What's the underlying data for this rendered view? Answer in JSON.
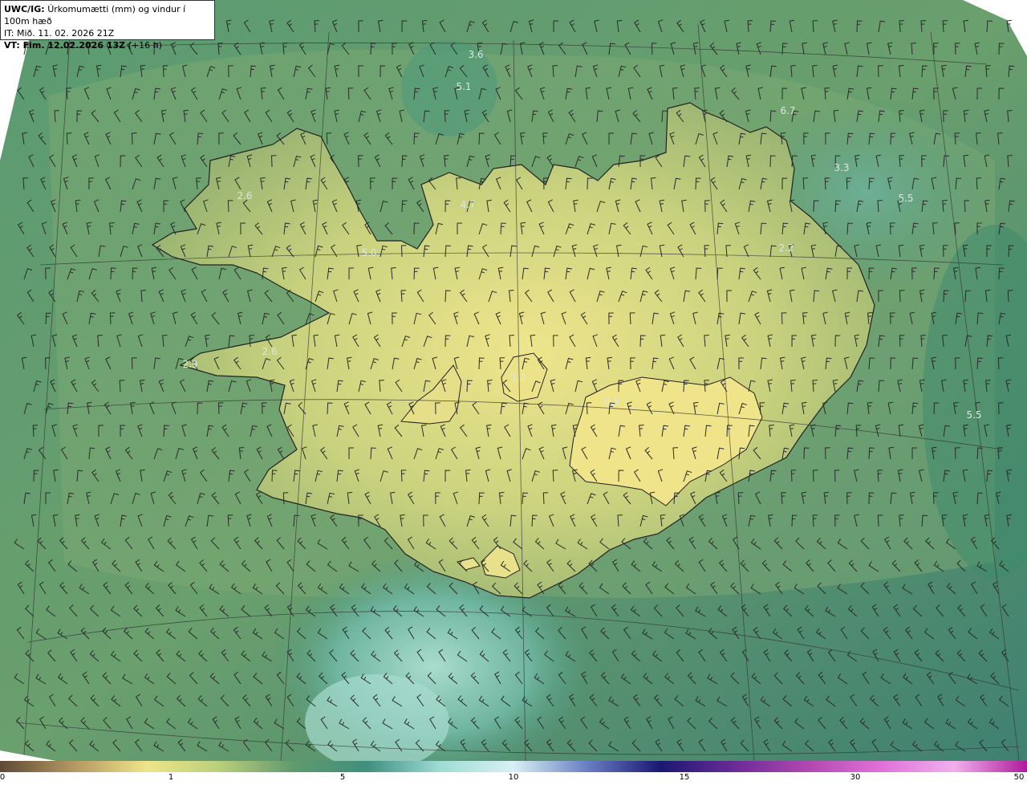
{
  "info": {
    "product": "UWC/IG:",
    "title": "Úrkomumætti (mm) og vindur í 100m hæð",
    "it_label": "IT:",
    "it_value": "Mið. 11. 02. 2026 21Z",
    "vt_label": "VT: Fim. 12.02.2026 13Z",
    "vt_extra": "(+16 h)"
  },
  "map_labels": [
    {
      "text": "3.6",
      "pos": [
        593,
        72
      ]
    },
    {
      "text": "5.1",
      "pos": [
        578,
        112
      ]
    },
    {
      "text": "6.7",
      "pos": [
        982,
        142
      ]
    },
    {
      "text": "3.3",
      "pos": [
        1049,
        213
      ]
    },
    {
      "text": "5.5",
      "pos": [
        1129,
        251
      ]
    },
    {
      "text": "2.6",
      "pos": [
        305,
        248
      ]
    },
    {
      "text": "4.7",
      "pos": [
        583,
        259
      ]
    },
    {
      "text": "5.0",
      "pos": [
        460,
        319
      ]
    },
    {
      "text": "2.2",
      "pos": [
        980,
        313
      ]
    },
    {
      "text": "2.6",
      "pos": [
        336,
        442
      ]
    },
    {
      "text": "2.9",
      "pos": [
        237,
        458
      ]
    },
    {
      "text": "1.2",
      "pos": [
        646,
        474
      ]
    },
    {
      "text": "0.9",
      "pos": [
        763,
        505
      ]
    },
    {
      "text": "5.5",
      "pos": [
        1214,
        521
      ]
    }
  ],
  "colorbar": {
    "labels": [
      "0",
      "1",
      "5",
      "10",
      "15",
      "30",
      "50"
    ],
    "colors": [
      "#5e4a35",
      "#b39660",
      "#efe58a",
      "#b9cf7a",
      "#5f9a6e",
      "#3f8f7e",
      "#9fdcd4",
      "#d8f0f4",
      "#6b7fc4",
      "#1a1870",
      "#6a2a96",
      "#b048b0",
      "#e070d8",
      "#f0b0ec",
      "#b01a9c"
    ]
  },
  "legend_colors": {
    "land_low": "#eee58c",
    "land_mid": "#b4c878",
    "sea": "#5a9478",
    "sea_dark": "#3f7f6a",
    "sea_light": "#8cc9b8"
  },
  "icons": [
    "wind-barb-icon"
  ]
}
